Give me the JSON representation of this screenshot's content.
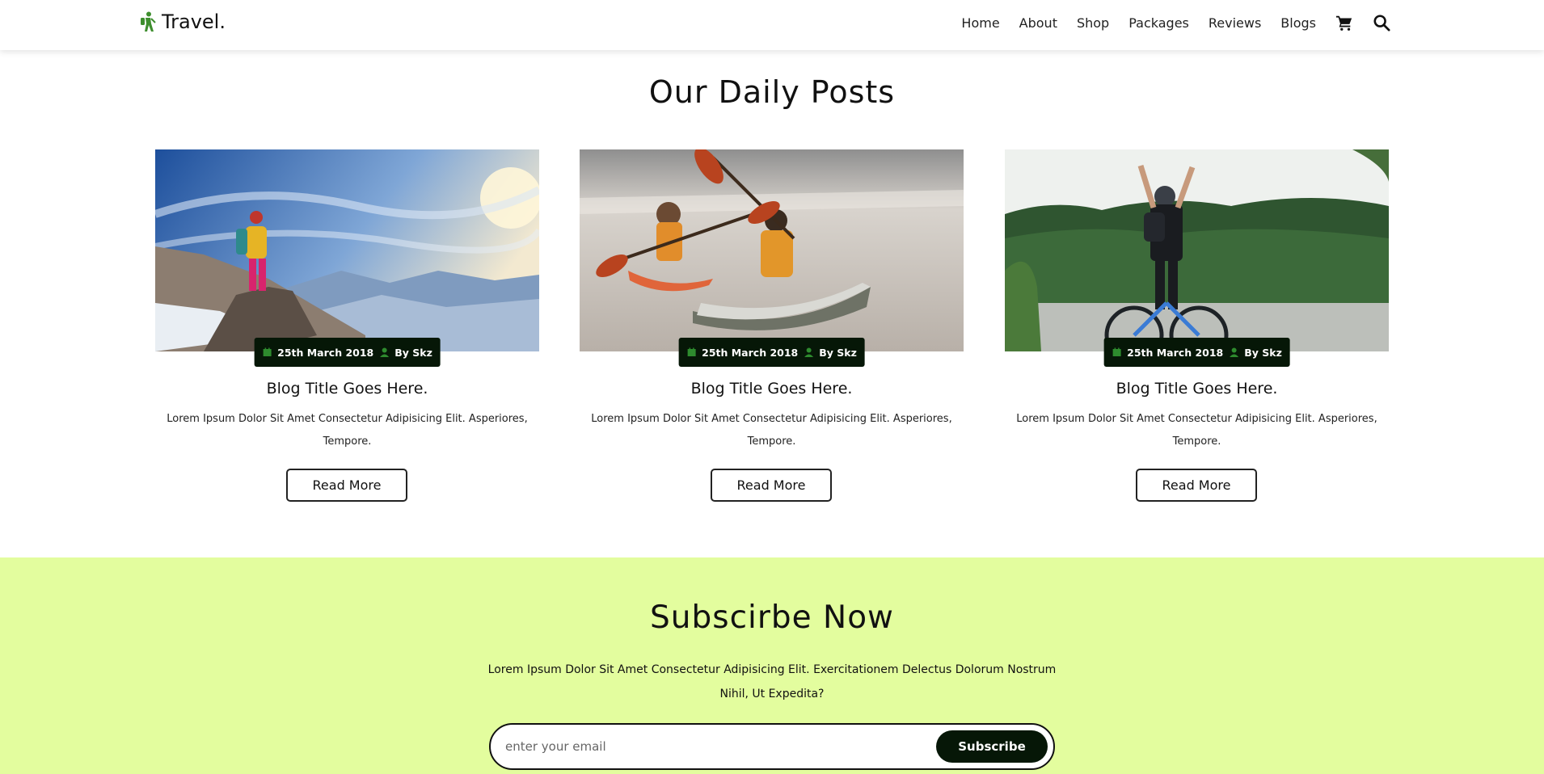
{
  "header": {
    "logo_text": "Travel.",
    "nav": [
      "Home",
      "About",
      "Shop",
      "Packages",
      "Reviews",
      "Blogs"
    ],
    "icons": [
      "hiker-icon",
      "cart-icon",
      "search-icon"
    ],
    "brand_color": "#3e8e2e"
  },
  "posts": {
    "title": "Our Daily Posts",
    "cards": [
      {
        "image": "mountain-hiker-photo",
        "date": "25th March 2018",
        "author": "By Skz",
        "title": "Blog Title Goes Here.",
        "text": "Lorem Ipsum Dolor Sit Amet Consectetur Adipisicing Elit. Asperiores, Tempore.",
        "button": "Read More"
      },
      {
        "image": "kayakers-photo",
        "date": "25th March 2018",
        "author": "By Skz",
        "title": "Blog Title Goes Here.",
        "text": "Lorem Ipsum Dolor Sit Amet Consectetur Adipisicing Elit. Asperiores, Tempore.",
        "button": "Read More"
      },
      {
        "image": "cyclist-lake-photo",
        "date": "25th March 2018",
        "author": "By Skz",
        "title": "Blog Title Goes Here.",
        "text": "Lorem Ipsum Dolor Sit Amet Consectetur Adipisicing Elit. Asperiores, Tempore.",
        "button": "Read More"
      }
    ],
    "meta_color": "#061707",
    "meta_icon_color": "#2e8b2e"
  },
  "subscribe": {
    "title": "Subscirbe Now",
    "text": "Lorem Ipsum Dolor Sit Amet Consectetur Adipisicing Elit. Exercitationem Delectus Dolorum Nostrum Nihil, Ut Expedita?",
    "placeholder": "enter your email",
    "button": "Subscribe",
    "bg_color": "#e3fd9e"
  }
}
